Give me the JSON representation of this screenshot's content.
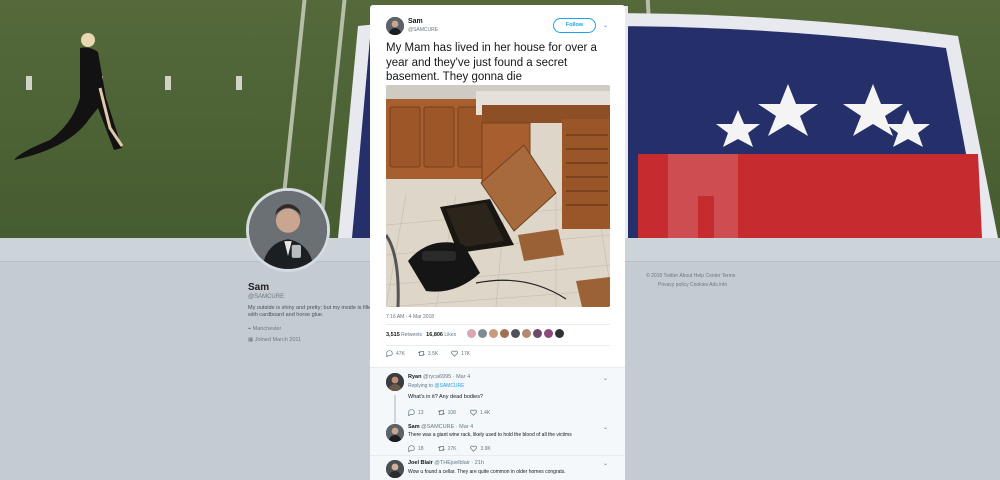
{
  "profile": {
    "name": "Sam",
    "handle": "@SAMCURE",
    "bio": "My outside is shiny and pretty; but my inside is filled with cardboard and horse glue.",
    "location": "Manchester",
    "joined": "Joined March 2011"
  },
  "footer": {
    "line1": "© 2018 Twitter  About  Help Center  Terms",
    "line2": "Privacy policy  Cookies  Ads info"
  },
  "tweet": {
    "author_name": "Sam",
    "author_handle": "@SAMCURE",
    "follow_label": "Follow",
    "text": "My Mam has lived in her house for over a year and they've just found a secret basement. They gonna die",
    "timestamp": "7:16 AM - 4 Mar 2018",
    "retweets_count": "3,515",
    "retweets_label": "Retweets",
    "likes_count": "16,806",
    "likes_label": "Likes",
    "reply_count": "47K",
    "retweet_action_count": "3.5K",
    "like_action_count": "17K"
  },
  "replies": [
    {
      "name": "Ryan",
      "handle": "@ryca6995",
      "date": "· Mar 4",
      "replying_to_prefix": "Replying to",
      "replying_to": "@SAMCURE",
      "text": "What's in it? Any dead bodies?",
      "reply_count": "13",
      "retweet_count": "108",
      "like_count": "1.4K"
    },
    {
      "name": "Sam",
      "handle": "@SAMCURE",
      "date": "· Mar 4",
      "text": "There was a giant wine rack, likely used to hold the blood of all the victims",
      "reply_count": "18",
      "retweet_count": "27K",
      "like_count": "3.9K"
    },
    {
      "name": "Joel Blair",
      "handle": "@THEjoelblair",
      "date": "· 21h",
      "text": "Wow u found a cellar. They are quite common in older homes congrats."
    }
  ],
  "icons": {
    "reply": "reply-icon",
    "retweet": "retweet-icon",
    "like": "heart-icon",
    "chevron": "chevron-down-icon",
    "location": "location-pin-icon",
    "calendar": "calendar-icon"
  },
  "colors": {
    "accent": "#1da1f2",
    "text": "#14171a",
    "muted": "#657786"
  }
}
